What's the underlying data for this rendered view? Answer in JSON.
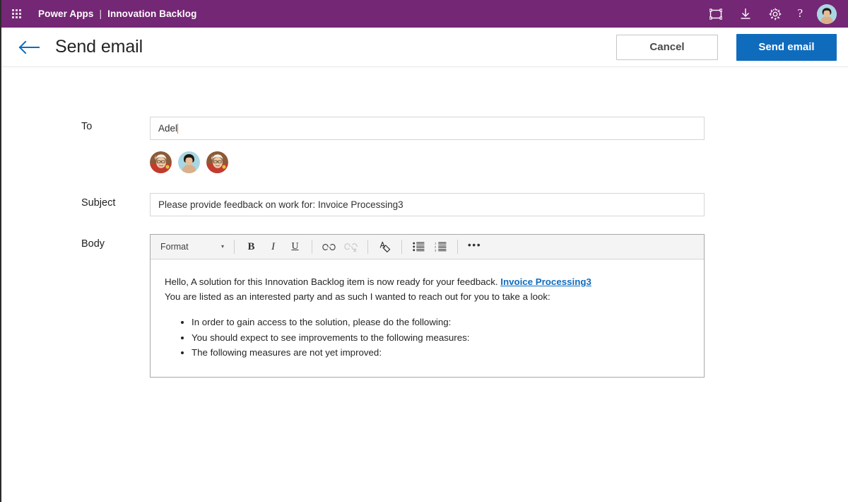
{
  "appbar": {
    "waffle_icon": "waffle-grid-icon",
    "product": "Power Apps",
    "separator": "|",
    "app_name": "Innovation Backlog",
    "icons": [
      {
        "name": "fit-to-screen-icon",
        "label": "Fit to screen"
      },
      {
        "name": "download-icon",
        "label": "Download"
      },
      {
        "name": "gear-icon",
        "label": "Settings"
      }
    ],
    "help_glyph": "?",
    "avatar_label": "Account manager"
  },
  "commandbar": {
    "back_icon": "back-arrow-icon",
    "title": "Send email",
    "cancel_label": "Cancel",
    "send_label": "Send email"
  },
  "form": {
    "to": {
      "label": "To",
      "value": "Adel",
      "placeholder": "",
      "people": [
        {
          "name": "person-avatar-1"
        },
        {
          "name": "person-avatar-2"
        },
        {
          "name": "person-avatar-3"
        }
      ]
    },
    "subject": {
      "label": "Subject",
      "value": "Please provide feedback on work for: Invoice Processing3",
      "placeholder": ""
    },
    "body": {
      "label": "Body",
      "toolbar": {
        "format_label": "Format",
        "caret_glyph": "▾",
        "bold_glyph": "B",
        "italic_glyph": "I",
        "underline_glyph": "U",
        "link_icon": "link-icon",
        "unlink_icon": "unlink-icon",
        "clear_format_icon": "clear-formatting-icon",
        "bullet_list_icon": "bullet-list-icon",
        "numbered_list_icon": "numbered-list-icon",
        "more_glyph": "•••"
      },
      "content": {
        "line1_before_link": "Hello, A solution for this Innovation Backlog item is now ready for your feedback. ",
        "line1_link": "Invoice Processing3",
        "line2": "You are listed as an interested party and as such I wanted to reach out for you to take a look:",
        "bullets": [
          "In order to gain access to the solution, please do the following:",
          "You should expect to see improvements to the following measures:",
          "The following measures are not yet improved:"
        ]
      }
    }
  },
  "colors": {
    "brand_purple": "#742774",
    "primary_blue": "#0f6cbd",
    "link_blue": "#0f6cbd",
    "back_arrow_blue": "#0f6cbd",
    "caret_orange": "#d98324"
  }
}
